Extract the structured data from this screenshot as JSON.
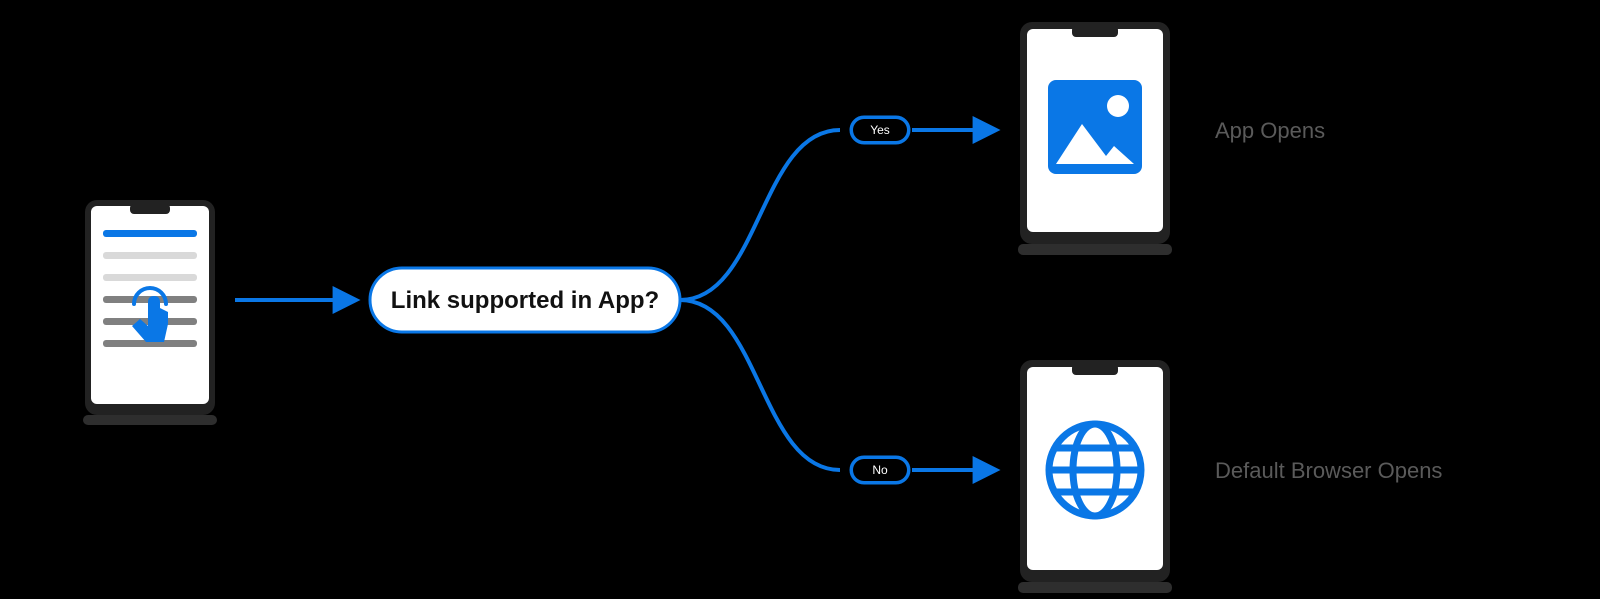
{
  "colors": {
    "accent": "#0a77e6",
    "phoneBody": "#222222",
    "phoneScreen": "#ffffff",
    "placeholder": "#d9d9d9",
    "text": "#5a5a5a"
  },
  "diagram": {
    "start": {
      "name": "user-taps-link"
    },
    "decision": {
      "label": "Link supported in App?"
    },
    "edges": {
      "yes": {
        "label": "Yes"
      },
      "no": {
        "label": "No"
      }
    },
    "outcomes": {
      "yes": {
        "label": "App Opens",
        "icon": "image-icon"
      },
      "no": {
        "label": "Default Browser Opens",
        "icon": "globe-icon"
      }
    }
  }
}
